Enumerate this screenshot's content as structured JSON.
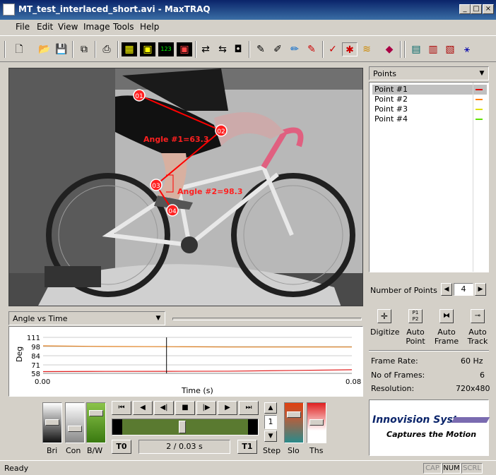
{
  "window": {
    "title": "MT_test_interlaced_short.avi - MaxTRAQ"
  },
  "menu": [
    "File",
    "Edit",
    "View",
    "Image",
    "Tools",
    "Help"
  ],
  "toolbar": {
    "icons": [
      "new-icon",
      "open-folder-icon",
      "save-icon",
      "copy-icon",
      "print-icon",
      "grid-icon",
      "frame-icon",
      "frame-123-icon",
      "frame-red-icon",
      "swap-icon",
      "arrows-icon",
      "move-points-icon",
      "pen-icon",
      "pen-sparkle-icon",
      "pen-edit-icon",
      "pen-red-icon",
      "check-icon",
      "figure-icon",
      "wave-icon",
      "book-icon",
      "calculator-icon",
      "chart-icon",
      "export-icon",
      "magic-wand-icon"
    ]
  },
  "video": {
    "markers": [
      "01",
      "02",
      "03",
      "04"
    ],
    "angles": [
      "Angle #1=63.3",
      "Angle #2=98.3"
    ]
  },
  "points_panel": {
    "dropdown": "Points",
    "items": [
      {
        "label": "Point #1",
        "color": "#e00000"
      },
      {
        "label": "Point #2",
        "color": "#ff8000"
      },
      {
        "label": "Point #3",
        "color": "#e0e000"
      },
      {
        "label": "Point #4",
        "color": "#60e000"
      }
    ],
    "number_label": "Number of Points",
    "number_value": "4"
  },
  "tools": [
    {
      "label1": "Digitize",
      "label2": ""
    },
    {
      "label1": "Auto",
      "label2": "Point"
    },
    {
      "label1": "Auto",
      "label2": "Frame"
    },
    {
      "label1": "Auto",
      "label2": "Track"
    }
  ],
  "info": {
    "frame_rate_label": "Frame Rate:",
    "frame_rate": "60 Hz",
    "frames_label": "No of Frames:",
    "frames": "6",
    "resolution_label": "Resolution:",
    "resolution": "720x480"
  },
  "logo": {
    "line1": "Innovision Systems",
    "line2": "Captures the Motion"
  },
  "graph": {
    "dropdown": "Angle vs Time",
    "ylabel": "Deg",
    "xlabel": "Time (s)",
    "yticks": [
      "111",
      "98",
      "84",
      "71",
      "58"
    ],
    "xmin_label": "0.00",
    "xmax_label": "0.08"
  },
  "chart_data": {
    "type": "line",
    "x": [
      0.0,
      0.0167,
      0.0333,
      0.05,
      0.0667,
      0.0833
    ],
    "series": [
      {
        "values": [
          98.5,
          97.6,
          97.3,
          96.8,
          96.8,
          96.8
        ],
        "color": "#e08020"
      },
      {
        "values": [
          60.6,
          60.9,
          61.0,
          61.2,
          62.2,
          63.3
        ],
        "color": "#e02020"
      }
    ],
    "ylim": [
      58,
      111
    ],
    "xlim": [
      0.0,
      0.0833
    ],
    "cursor_x": 0.0333
  },
  "playback": {
    "buttons": [
      "⏮",
      "◀",
      "◀|",
      "■",
      "|▶",
      "▶",
      "⏭"
    ],
    "t0": "T0",
    "t1": "T1",
    "frame_text": "2 /  0.03 s",
    "position": 0.2,
    "step_value": "1",
    "step_label": "Step"
  },
  "sliders": [
    {
      "label": "Bri",
      "level": 0.5
    },
    {
      "label": "Con",
      "level": 0.3
    },
    {
      "label": "B/W",
      "level": 0.8
    },
    {
      "label": "Slo",
      "level": 0.75
    },
    {
      "label": "Ths",
      "level": 0.5
    }
  ],
  "status": {
    "text": "Ready",
    "panes": [
      "CAP",
      "NUM",
      "SCRL"
    ]
  }
}
